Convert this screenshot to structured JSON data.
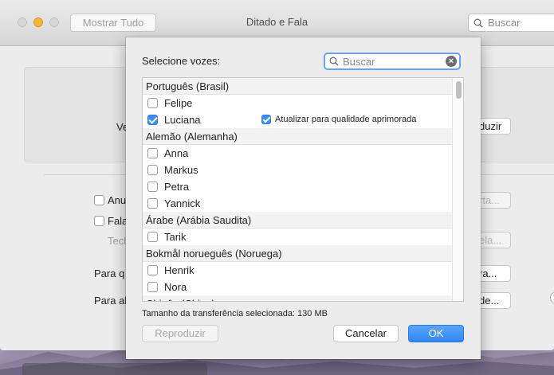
{
  "window": {
    "title": "Ditado e Fala",
    "show_all_label": "Mostrar Tudo",
    "search_placeholder": "Buscar"
  },
  "background_fragments": {
    "ve": "Ve",
    "reproduzir_partial": "duzir",
    "anu": "Anu",
    "fala": "Fala",
    "tecl": "Tecl",
    "para_q": "Para q",
    "para_a": "Para al",
    "btn_rta": "rta...",
    "btn_ela": "ela...",
    "btn_ra": "ra...",
    "btn_de": "de..."
  },
  "sheet": {
    "label": "Selecione vozes:",
    "search_value": "Buscar",
    "groups": [
      {
        "name": "Português (Brasil)",
        "voices": [
          {
            "name": "Felipe",
            "checked": false
          },
          {
            "name": "Luciana",
            "checked": true,
            "upgrade": {
              "label": "Atualizar para qualidade aprimorada",
              "checked": true
            }
          }
        ]
      },
      {
        "name": "Alemão (Alemanha)",
        "voices": [
          {
            "name": "Anna",
            "checked": false
          },
          {
            "name": "Markus",
            "checked": false
          },
          {
            "name": "Petra",
            "checked": false
          },
          {
            "name": "Yannick",
            "checked": false
          }
        ]
      },
      {
        "name": "Árabe (Arábia Saudita)",
        "voices": [
          {
            "name": "Tarik",
            "checked": false
          }
        ]
      },
      {
        "name": "Bokmål norueguês (Noruega)",
        "voices": [
          {
            "name": "Henrik",
            "checked": false
          },
          {
            "name": "Nora",
            "checked": false
          }
        ]
      },
      {
        "name": "Chinês (China)",
        "voices": []
      }
    ],
    "size_text": "Tamanho da transferência selecionada: 130 MB",
    "buttons": {
      "play": "Reproduzir",
      "cancel": "Cancelar",
      "ok": "OK"
    }
  },
  "colors": {
    "accent": "#3a8ef6",
    "minimize": "#f5b53a"
  }
}
